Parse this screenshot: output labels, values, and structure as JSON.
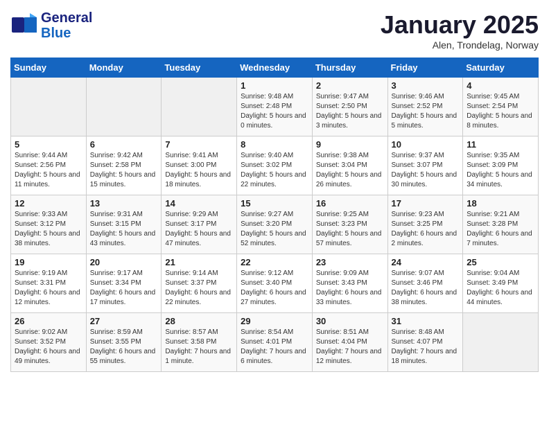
{
  "header": {
    "logo_line1": "General",
    "logo_line2": "Blue",
    "month_title": "January 2025",
    "location": "Alen, Trondelag, Norway"
  },
  "days_of_week": [
    "Sunday",
    "Monday",
    "Tuesday",
    "Wednesday",
    "Thursday",
    "Friday",
    "Saturday"
  ],
  "weeks": [
    [
      {
        "day": "",
        "sunrise": "",
        "sunset": "",
        "daylight": ""
      },
      {
        "day": "",
        "sunrise": "",
        "sunset": "",
        "daylight": ""
      },
      {
        "day": "",
        "sunrise": "",
        "sunset": "",
        "daylight": ""
      },
      {
        "day": "1",
        "sunrise": "Sunrise: 9:48 AM",
        "sunset": "Sunset: 2:48 PM",
        "daylight": "Daylight: 5 hours and 0 minutes."
      },
      {
        "day": "2",
        "sunrise": "Sunrise: 9:47 AM",
        "sunset": "Sunset: 2:50 PM",
        "daylight": "Daylight: 5 hours and 3 minutes."
      },
      {
        "day": "3",
        "sunrise": "Sunrise: 9:46 AM",
        "sunset": "Sunset: 2:52 PM",
        "daylight": "Daylight: 5 hours and 5 minutes."
      },
      {
        "day": "4",
        "sunrise": "Sunrise: 9:45 AM",
        "sunset": "Sunset: 2:54 PM",
        "daylight": "Daylight: 5 hours and 8 minutes."
      }
    ],
    [
      {
        "day": "5",
        "sunrise": "Sunrise: 9:44 AM",
        "sunset": "Sunset: 2:56 PM",
        "daylight": "Daylight: 5 hours and 11 minutes."
      },
      {
        "day": "6",
        "sunrise": "Sunrise: 9:42 AM",
        "sunset": "Sunset: 2:58 PM",
        "daylight": "Daylight: 5 hours and 15 minutes."
      },
      {
        "day": "7",
        "sunrise": "Sunrise: 9:41 AM",
        "sunset": "Sunset: 3:00 PM",
        "daylight": "Daylight: 5 hours and 18 minutes."
      },
      {
        "day": "8",
        "sunrise": "Sunrise: 9:40 AM",
        "sunset": "Sunset: 3:02 PM",
        "daylight": "Daylight: 5 hours and 22 minutes."
      },
      {
        "day": "9",
        "sunrise": "Sunrise: 9:38 AM",
        "sunset": "Sunset: 3:04 PM",
        "daylight": "Daylight: 5 hours and 26 minutes."
      },
      {
        "day": "10",
        "sunrise": "Sunrise: 9:37 AM",
        "sunset": "Sunset: 3:07 PM",
        "daylight": "Daylight: 5 hours and 30 minutes."
      },
      {
        "day": "11",
        "sunrise": "Sunrise: 9:35 AM",
        "sunset": "Sunset: 3:09 PM",
        "daylight": "Daylight: 5 hours and 34 minutes."
      }
    ],
    [
      {
        "day": "12",
        "sunrise": "Sunrise: 9:33 AM",
        "sunset": "Sunset: 3:12 PM",
        "daylight": "Daylight: 5 hours and 38 minutes."
      },
      {
        "day": "13",
        "sunrise": "Sunrise: 9:31 AM",
        "sunset": "Sunset: 3:15 PM",
        "daylight": "Daylight: 5 hours and 43 minutes."
      },
      {
        "day": "14",
        "sunrise": "Sunrise: 9:29 AM",
        "sunset": "Sunset: 3:17 PM",
        "daylight": "Daylight: 5 hours and 47 minutes."
      },
      {
        "day": "15",
        "sunrise": "Sunrise: 9:27 AM",
        "sunset": "Sunset: 3:20 PM",
        "daylight": "Daylight: 5 hours and 52 minutes."
      },
      {
        "day": "16",
        "sunrise": "Sunrise: 9:25 AM",
        "sunset": "Sunset: 3:23 PM",
        "daylight": "Daylight: 5 hours and 57 minutes."
      },
      {
        "day": "17",
        "sunrise": "Sunrise: 9:23 AM",
        "sunset": "Sunset: 3:25 PM",
        "daylight": "Daylight: 6 hours and 2 minutes."
      },
      {
        "day": "18",
        "sunrise": "Sunrise: 9:21 AM",
        "sunset": "Sunset: 3:28 PM",
        "daylight": "Daylight: 6 hours and 7 minutes."
      }
    ],
    [
      {
        "day": "19",
        "sunrise": "Sunrise: 9:19 AM",
        "sunset": "Sunset: 3:31 PM",
        "daylight": "Daylight: 6 hours and 12 minutes."
      },
      {
        "day": "20",
        "sunrise": "Sunrise: 9:17 AM",
        "sunset": "Sunset: 3:34 PM",
        "daylight": "Daylight: 6 hours and 17 minutes."
      },
      {
        "day": "21",
        "sunrise": "Sunrise: 9:14 AM",
        "sunset": "Sunset: 3:37 PM",
        "daylight": "Daylight: 6 hours and 22 minutes."
      },
      {
        "day": "22",
        "sunrise": "Sunrise: 9:12 AM",
        "sunset": "Sunset: 3:40 PM",
        "daylight": "Daylight: 6 hours and 27 minutes."
      },
      {
        "day": "23",
        "sunrise": "Sunrise: 9:09 AM",
        "sunset": "Sunset: 3:43 PM",
        "daylight": "Daylight: 6 hours and 33 minutes."
      },
      {
        "day": "24",
        "sunrise": "Sunrise: 9:07 AM",
        "sunset": "Sunset: 3:46 PM",
        "daylight": "Daylight: 6 hours and 38 minutes."
      },
      {
        "day": "25",
        "sunrise": "Sunrise: 9:04 AM",
        "sunset": "Sunset: 3:49 PM",
        "daylight": "Daylight: 6 hours and 44 minutes."
      }
    ],
    [
      {
        "day": "26",
        "sunrise": "Sunrise: 9:02 AM",
        "sunset": "Sunset: 3:52 PM",
        "daylight": "Daylight: 6 hours and 49 minutes."
      },
      {
        "day": "27",
        "sunrise": "Sunrise: 8:59 AM",
        "sunset": "Sunset: 3:55 PM",
        "daylight": "Daylight: 6 hours and 55 minutes."
      },
      {
        "day": "28",
        "sunrise": "Sunrise: 8:57 AM",
        "sunset": "Sunset: 3:58 PM",
        "daylight": "Daylight: 7 hours and 1 minute."
      },
      {
        "day": "29",
        "sunrise": "Sunrise: 8:54 AM",
        "sunset": "Sunset: 4:01 PM",
        "daylight": "Daylight: 7 hours and 6 minutes."
      },
      {
        "day": "30",
        "sunrise": "Sunrise: 8:51 AM",
        "sunset": "Sunset: 4:04 PM",
        "daylight": "Daylight: 7 hours and 12 minutes."
      },
      {
        "day": "31",
        "sunrise": "Sunrise: 8:48 AM",
        "sunset": "Sunset: 4:07 PM",
        "daylight": "Daylight: 7 hours and 18 minutes."
      },
      {
        "day": "",
        "sunrise": "",
        "sunset": "",
        "daylight": ""
      }
    ]
  ]
}
